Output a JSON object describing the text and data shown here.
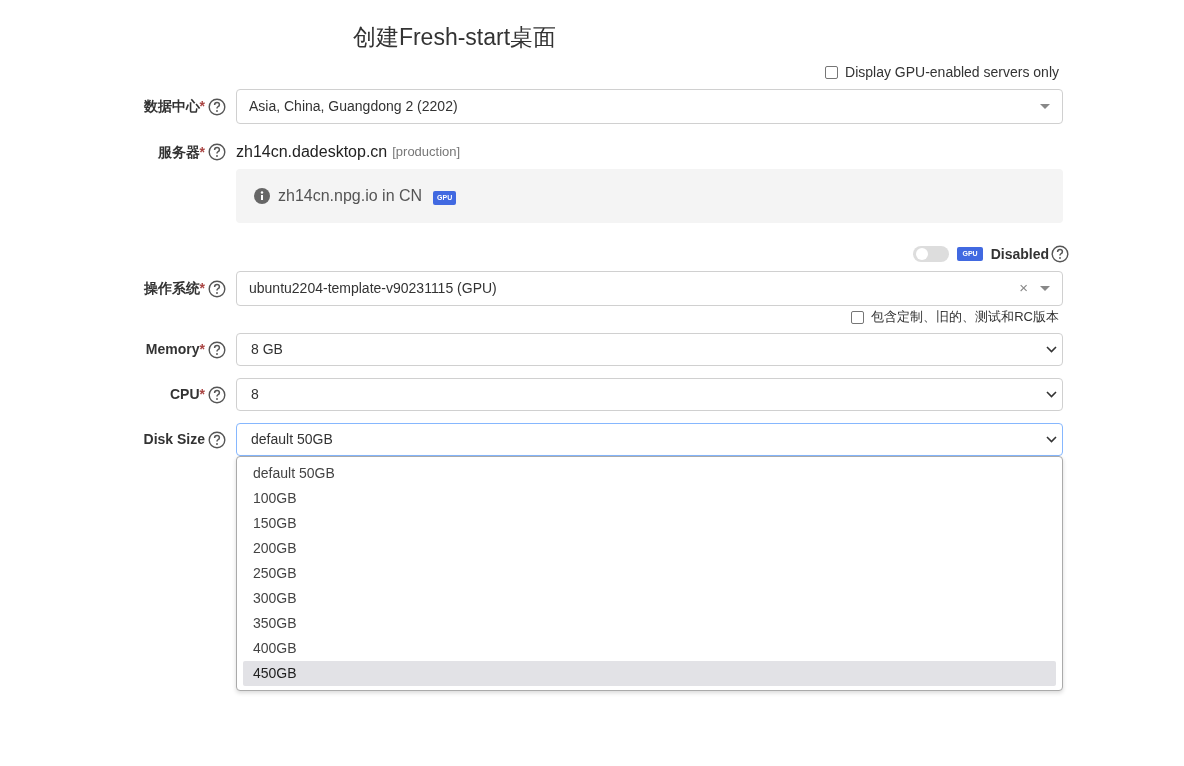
{
  "title": "创建Fresh-start桌面",
  "gpu_filter": {
    "label": "Display GPU-enabled servers only",
    "checked": false
  },
  "datacenter": {
    "label": "数据中心",
    "required_mark": "*",
    "value": "Asia, China, Guangdong 2 (2202)"
  },
  "server": {
    "label": "服务器",
    "required_mark": "*",
    "host": "zh14cn.dadesktop.cn",
    "env": "[production]",
    "info_text": "zh14cn.npg.io in CN",
    "info_badge": "GPU"
  },
  "gpu_toggle": {
    "on": false,
    "badge": "GPU",
    "label": "Disabled"
  },
  "os": {
    "label": "操作系统",
    "required_mark": "*",
    "value": "ubuntu2204-template-v90231115 (GPU)",
    "clear": "×"
  },
  "include_all": {
    "label": "包含定制、旧的、测试和RC版本",
    "checked": false
  },
  "selects": [
    {
      "label": "Memory",
      "required_mark": "*",
      "value": "8 GB",
      "focused": false
    },
    {
      "label": "CPU",
      "required_mark": "*",
      "value": "8",
      "focused": false
    },
    {
      "label": "Disk Size",
      "value": "default 50GB",
      "focused": true
    }
  ],
  "disk_options": [
    {
      "label": "default 50GB",
      "selected": false
    },
    {
      "label": "100GB",
      "selected": false
    },
    {
      "label": "150GB",
      "selected": false
    },
    {
      "label": "200GB",
      "selected": false
    },
    {
      "label": "250GB",
      "selected": false
    },
    {
      "label": "300GB",
      "selected": false
    },
    {
      "label": "350GB",
      "selected": false
    },
    {
      "label": "400GB",
      "selected": false
    },
    {
      "label": "450GB",
      "selected": true
    }
  ]
}
